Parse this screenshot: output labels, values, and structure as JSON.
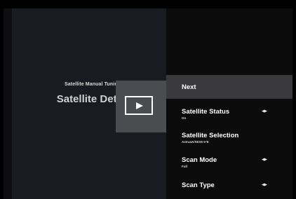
{
  "page": {
    "subtitle": "Satellite Manual Tuning",
    "title": "Satellite Detail"
  },
  "play_icon": "play-icon",
  "arrow_icon_glyph": "◀▶",
  "menu": [
    {
      "label": "Next",
      "value": "",
      "has_arrows": false,
      "selected": true
    },
    {
      "label": "Satellite Status",
      "value": "On",
      "has_arrows": true,
      "selected": false
    },
    {
      "label": "Satellite Selection",
      "value": "Astra4A/SES5 5°E",
      "has_arrows": false,
      "selected": false
    },
    {
      "label": "Scan Mode",
      "value": "Full",
      "has_arrows": true,
      "selected": false
    },
    {
      "label": "Scan Type",
      "value": "",
      "has_arrows": true,
      "selected": false
    }
  ],
  "colors": {
    "background": "#000000",
    "left_panel": "#181c20",
    "selected_row": "#3a3a3c",
    "play_box": "#4a4c50"
  }
}
